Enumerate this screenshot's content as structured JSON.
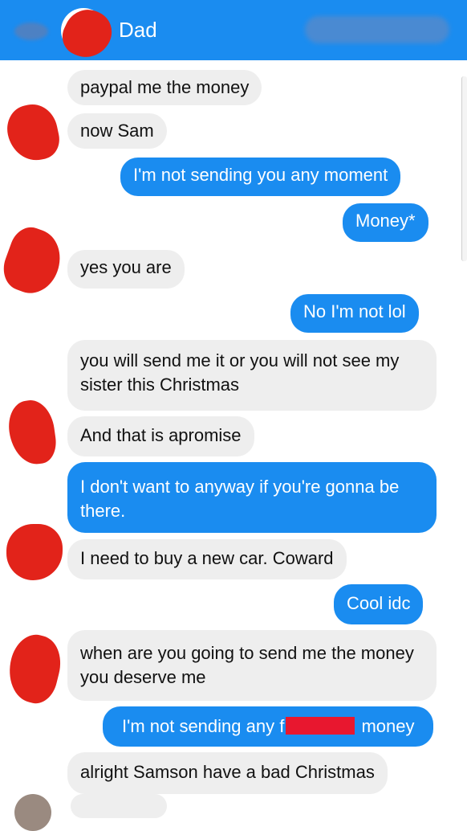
{
  "header": {
    "contact_name": "Dad"
  },
  "messages": [
    {
      "from": "them",
      "text": "paypal me the money"
    },
    {
      "from": "them",
      "text": "now Sam"
    },
    {
      "from": "me",
      "text": "I'm not sending you any moment"
    },
    {
      "from": "me",
      "text": "Money*"
    },
    {
      "from": "them",
      "text": "yes you are"
    },
    {
      "from": "me",
      "text": "No I'm not lol"
    },
    {
      "from": "them",
      "text": "you will send me it or you will not see my sister this Christmas"
    },
    {
      "from": "them",
      "text": "And that is apromise"
    },
    {
      "from": "me",
      "text": "I don't want to anyway if you're gonna be there."
    },
    {
      "from": "them",
      "text": "I need to buy a new car. Coward"
    },
    {
      "from": "me",
      "text": "Cool idc"
    },
    {
      "from": "them",
      "text": "when are you going to send me the money you deserve me"
    },
    {
      "from": "me",
      "text_before": "I'm not sending any f",
      "text_after": " money"
    },
    {
      "from": "them",
      "text": "alright Samson have a bad Christmas"
    }
  ],
  "colors": {
    "accent": "#1a8cf0",
    "incoming_bubble": "#eeeeee",
    "redaction": "#e2231a"
  }
}
